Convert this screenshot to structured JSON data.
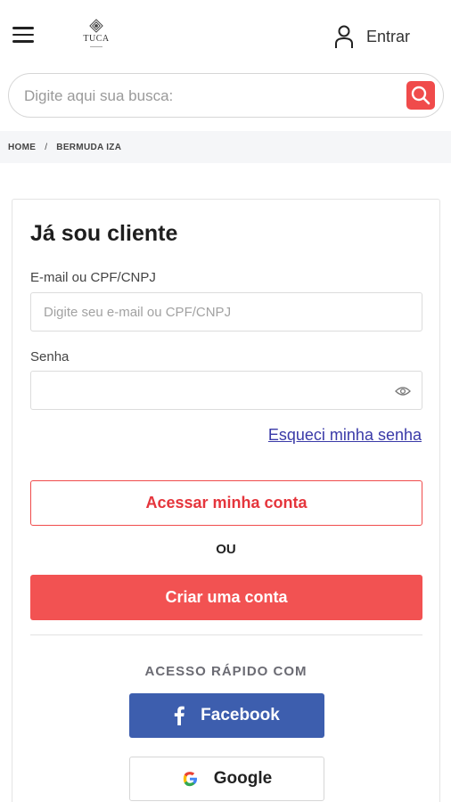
{
  "header": {
    "logo_text": "TUCA",
    "login_label": "Entrar"
  },
  "search": {
    "placeholder": "Digite aqui sua busca:"
  },
  "breadcrumb": {
    "items": [
      "HOME",
      "BERMUDA IZA"
    ],
    "separator": "/"
  },
  "login": {
    "title": "Já sou cliente",
    "email_label": "E-mail ou CPF/CNPJ",
    "email_placeholder": "Digite seu e-mail ou CPF/CNPJ",
    "password_label": "Senha",
    "forgot_link": "Esqueci minha senha",
    "submit_label": "Acessar minha conta",
    "or_text": "OU",
    "create_label": "Criar uma conta",
    "quick_access_label": "ACESSO RÁPIDO COM",
    "facebook_label": "Facebook",
    "google_label": "Google"
  },
  "colors": {
    "accent": "#f04b4b",
    "create_button": "#f25252",
    "facebook": "#3d5eae",
    "link": "#3a3aa8"
  }
}
